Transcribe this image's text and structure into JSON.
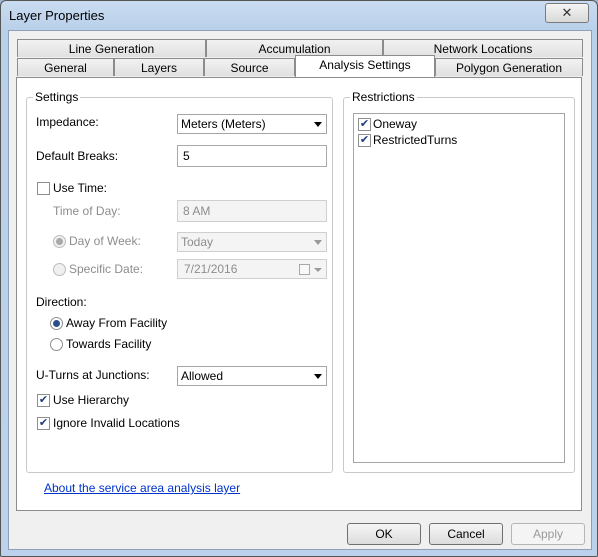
{
  "window": {
    "title": "Layer Properties",
    "close_icon": "close-icon"
  },
  "tabs": {
    "back_row": [
      "Line Generation",
      "Accumulation",
      "Network Locations"
    ],
    "front_row": [
      "General",
      "Layers",
      "Source",
      "Analysis Settings",
      "Polygon Generation"
    ],
    "active": "Analysis Settings"
  },
  "settings": {
    "group_title": "Settings",
    "impedance_label": "Impedance:",
    "impedance_value": "Meters (Meters)",
    "default_breaks_label": "Default Breaks:",
    "default_breaks_value": "5",
    "use_time_label": "Use Time:",
    "use_time_checked": false,
    "time_of_day_label": "Time of Day:",
    "time_of_day_value": "8 AM",
    "day_of_week_label": "Day of Week:",
    "day_of_week_value": "Today",
    "specific_date_label": "Specific Date:",
    "specific_date_value": "7/21/2016",
    "direction_label": "Direction:",
    "away_label": "Away From Facility",
    "towards_label": "Towards Facility",
    "direction_selected": "Away From Facility",
    "uturns_label": "U-Turns at Junctions:",
    "uturns_value": "Allowed",
    "use_hierarchy_label": "Use Hierarchy",
    "use_hierarchy_checked": true,
    "ignore_invalid_label": "Ignore Invalid Locations",
    "ignore_invalid_checked": true
  },
  "restrictions": {
    "group_title": "Restrictions",
    "items": [
      {
        "label": "Oneway",
        "checked": true
      },
      {
        "label": "RestrictedTurns",
        "checked": true
      }
    ]
  },
  "about_link": "About the service area analysis layer",
  "buttons": {
    "ok": "OK",
    "cancel": "Cancel",
    "apply": "Apply"
  }
}
